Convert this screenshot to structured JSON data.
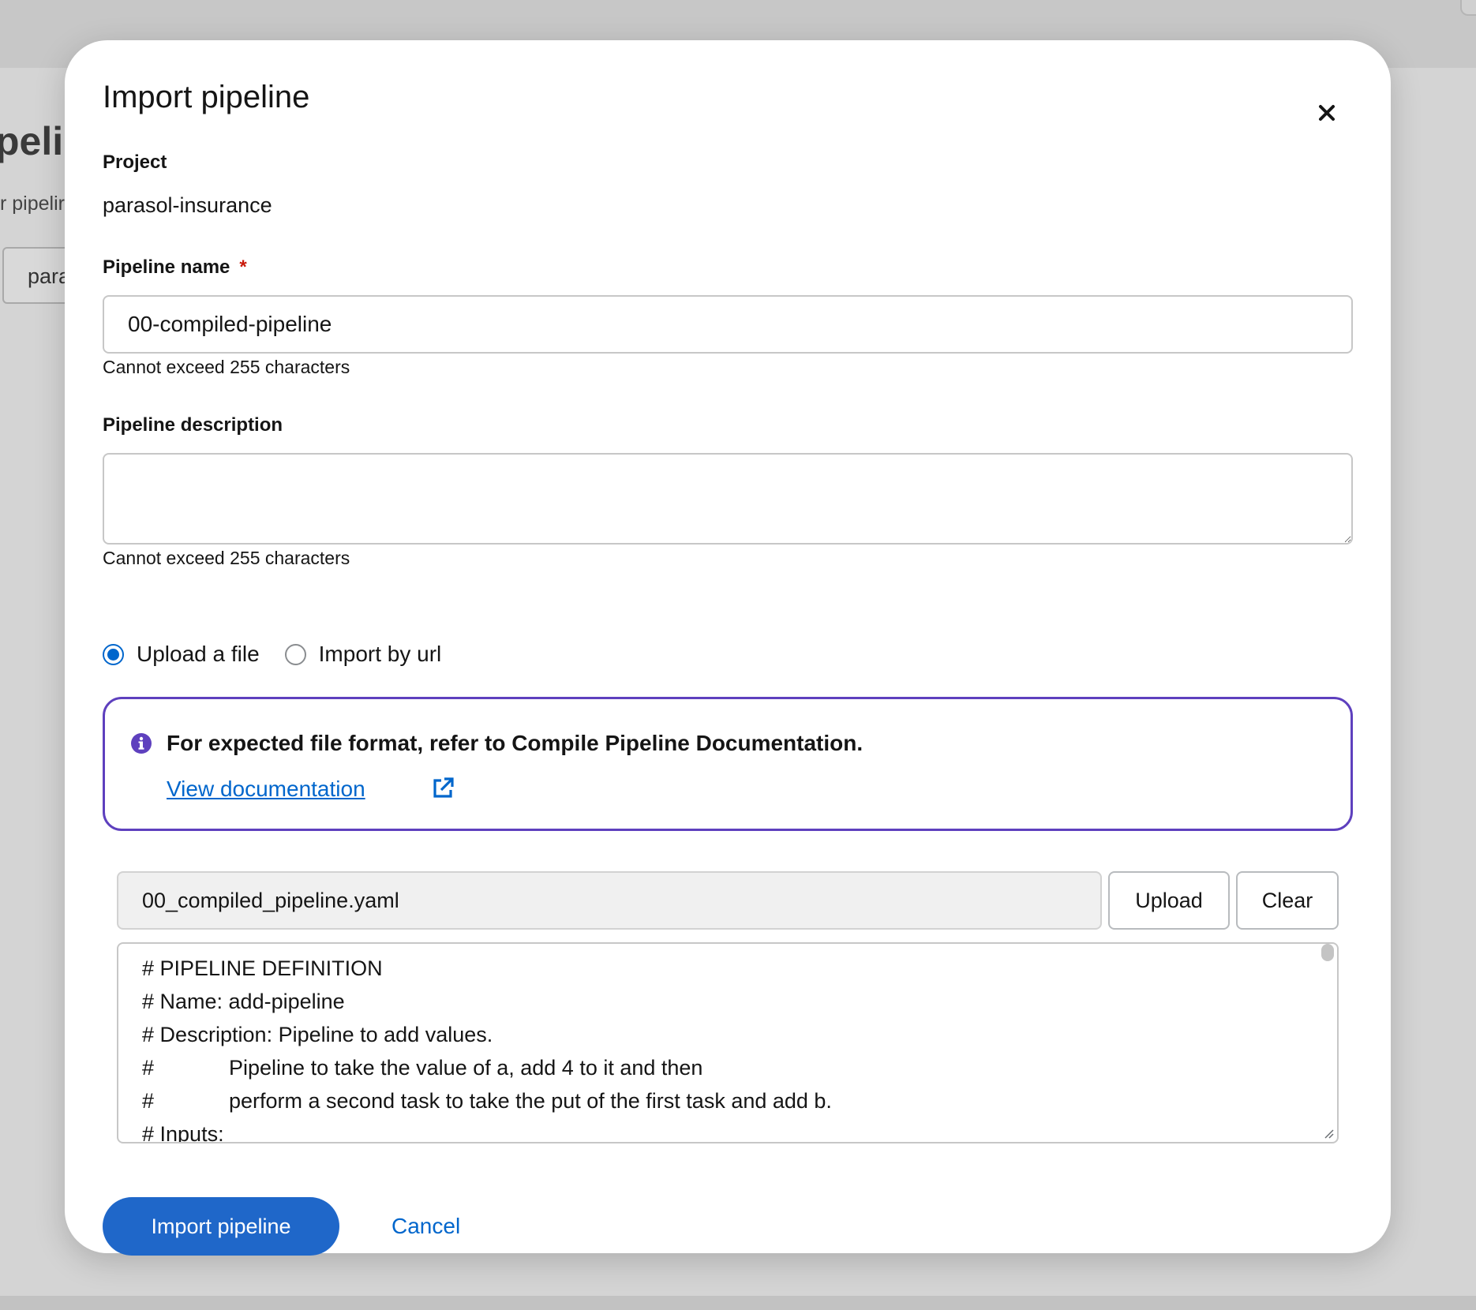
{
  "background": {
    "page_title_fragment": "pelin",
    "page_subtitle_fragment": "r pipelir",
    "project_select_fragment": "para"
  },
  "modal": {
    "title": "Import pipeline",
    "close_label": "Close",
    "project_label": "Project",
    "project_value": "parasol-insurance",
    "pipeline_name_label": "Pipeline name",
    "required_marker": "*",
    "pipeline_name_value": "00-compiled-pipeline",
    "pipeline_name_helper": "Cannot exceed 255 characters",
    "description_label": "Pipeline description",
    "description_value": "",
    "description_helper": "Cannot exceed 255 characters",
    "source_options": [
      {
        "label": "Upload a file",
        "selected": true
      },
      {
        "label": "Import by url",
        "selected": false
      }
    ],
    "info_alert": {
      "title": "For expected file format, refer to Compile Pipeline Documentation.",
      "link_text": "View documentation",
      "accent_color": "#5e40be"
    },
    "file_upload": {
      "file_name": "00_compiled_pipeline.yaml",
      "upload_label": "Upload",
      "clear_label": "Clear",
      "content_lines": [
        {
          "prefix": "# PIPELINE DEFINITION",
          "text": ""
        },
        {
          "prefix": "# Name: add-pipeline",
          "text": ""
        },
        {
          "prefix": "# Description: Pipeline to add values.",
          "text": ""
        },
        {
          "prefix": "#",
          "text": "Pipeline to take the value of a, add 4 to it and then"
        },
        {
          "prefix": "#",
          "text": "perform a second task to take the put of the first task and add b."
        },
        {
          "prefix": "# Inputs:",
          "text": ""
        }
      ]
    },
    "footer": {
      "primary_label": "Import pipeline",
      "cancel_label": "Cancel",
      "primary_color": "#1f67c9"
    }
  }
}
